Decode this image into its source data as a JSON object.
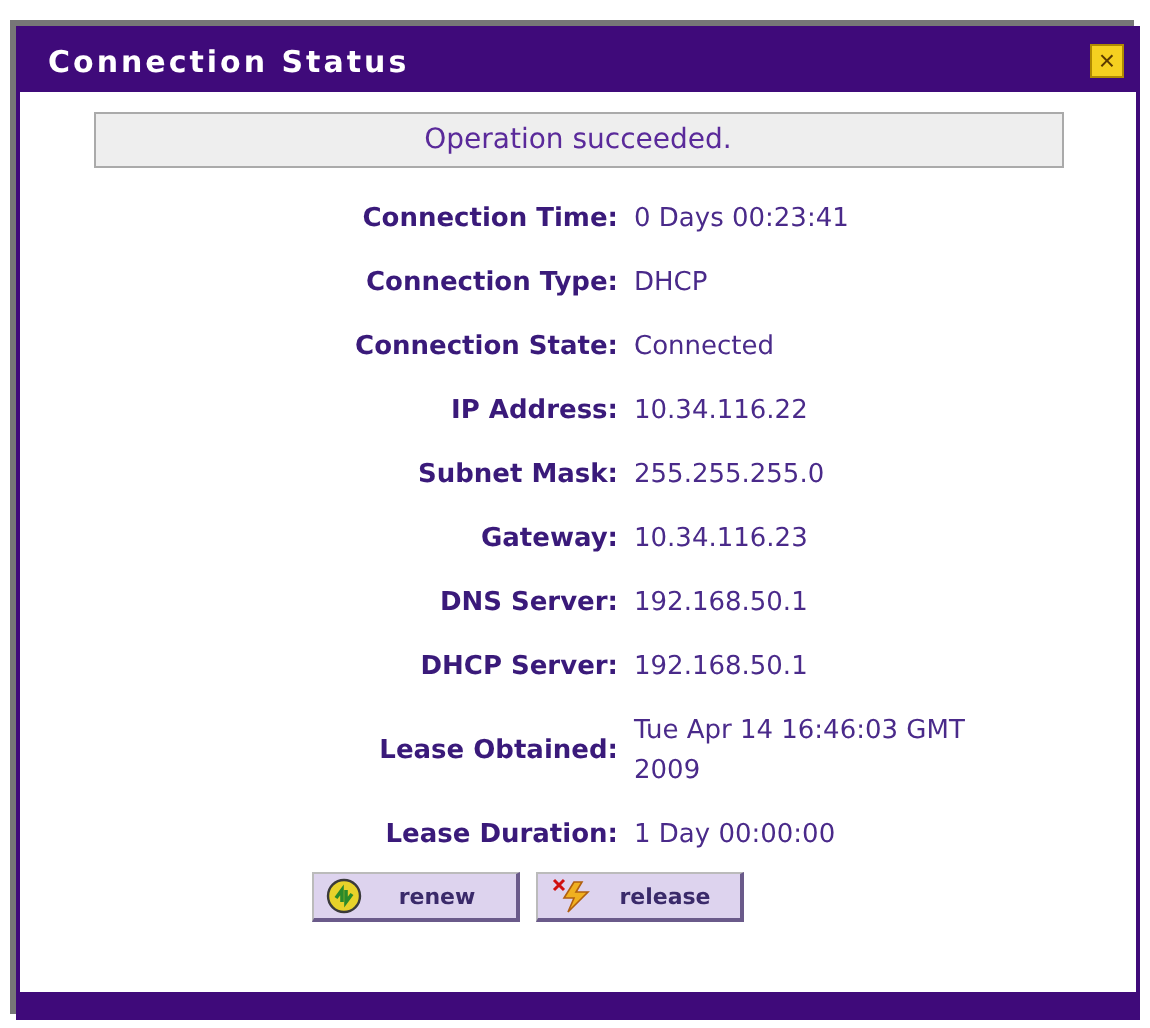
{
  "window": {
    "title": "Connection Status",
    "close": "×"
  },
  "message": "Operation succeeded.",
  "fields": [
    {
      "label": "Connection Time:",
      "value": "0 Days 00:23:41"
    },
    {
      "label": "Connection Type:",
      "value": "DHCP"
    },
    {
      "label": "Connection State:",
      "value": "Connected"
    },
    {
      "label": "IP Address:",
      "value": "10.34.116.22"
    },
    {
      "label": "Subnet Mask:",
      "value": "255.255.255.0"
    },
    {
      "label": "Gateway:",
      "value": "10.34.116.23"
    },
    {
      "label": "DNS Server:",
      "value": "192.168.50.1"
    },
    {
      "label": "DHCP Server:",
      "value": "192.168.50.1"
    },
    {
      "label": "Lease Obtained:",
      "value": "Tue Apr 14 16:46:03 GMT 2009"
    },
    {
      "label": "Lease Duration:",
      "value": "1 Day 00:00:00"
    }
  ],
  "buttons": [
    {
      "label": "renew",
      "kind": "renew"
    },
    {
      "label": "release",
      "kind": "release"
    }
  ]
}
